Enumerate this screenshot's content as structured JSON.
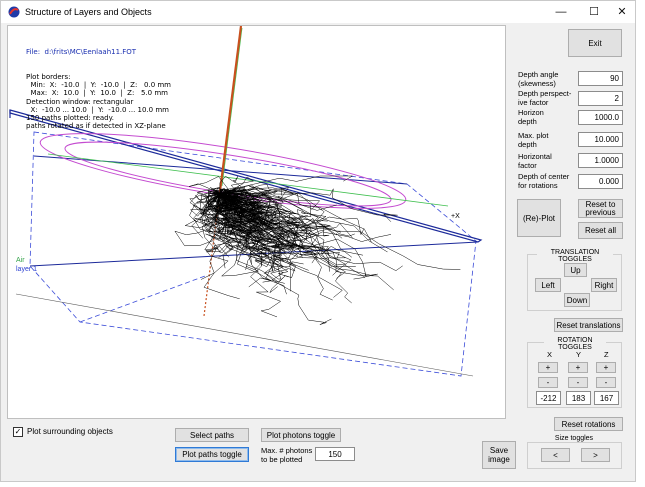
{
  "window": {
    "title": "Structure of Layers and Objects",
    "minimize": "—",
    "maximize": "☐",
    "close": "✕"
  },
  "info": {
    "file": "File:  d:\\frits\\MC\\Eenlaah11.FOT",
    "lines": "Plot borders:\n  Min:  X:  -10.0  |  Y:  -10.0  |  Z:   0.0 mm\n  Max:  X:  10.0  |  Y:  10.0  |  Z:   5.0 mm\nDetection window: rectangular\n  X:  -10.0 ... 10.0  |  Y:  -10.0 ... 10.0 mm\n150 paths plotted: ready.\npaths rotated as if detected in XZ-plane"
  },
  "canvas_labels": {
    "air": "Air",
    "layer": "layer 1",
    "axis_x": "+X"
  },
  "controls": {
    "exit": "Exit",
    "depth_angle_label": "Depth angle\n(skewness)",
    "depth_angle": "90",
    "depth_persp_label": "Depth perspect-\nive factor",
    "depth_persp": "2",
    "horizon_label": "Horizon\ndepth",
    "horizon": "1000.0",
    "max_plot_label": "Max. plot\ndepth",
    "max_plot": "10.000",
    "horiz_factor_label": "Horizontal\nfactor",
    "horiz_factor": "1.0000",
    "center_label": "Depth of center\nfor rotations",
    "center": "0.000",
    "replot": "(Re)-Plot",
    "reset_prev": "Reset to\nprevious",
    "reset_all": "Reset all"
  },
  "translation": {
    "title": "TRANSLATION TOGGLES",
    "up": "Up",
    "left": "Left",
    "right": "Right",
    "down": "Down",
    "reset": "Reset translations"
  },
  "rotation": {
    "title": "ROTATION TOGGLES",
    "x": "X",
    "y": "Y",
    "z": "Z",
    "plus": "+",
    "minus": "-",
    "x_val": "-212",
    "y_val": "183",
    "z_val": "167",
    "reset": "Reset rotations"
  },
  "size": {
    "title": "Size toggles",
    "smaller": "<",
    "larger": ">"
  },
  "bottom": {
    "plot_surrounding": "Plot surrounding objects",
    "plot_surrounding_checked": "✓",
    "select_paths": "Select paths",
    "plot_photons": "Plot photons toggle",
    "plot_paths": "Plot paths toggle",
    "max_photons_label": "Max. # photons\nto be plotted",
    "max_photons": "150",
    "save_image": "Save\nimage"
  },
  "colors": {
    "layer_plane": "#1c2a9a",
    "air_ellipse": "#c44bd0",
    "green_axis": "#3fbf4f",
    "detector": "#c8501e",
    "paths": "#000000"
  }
}
